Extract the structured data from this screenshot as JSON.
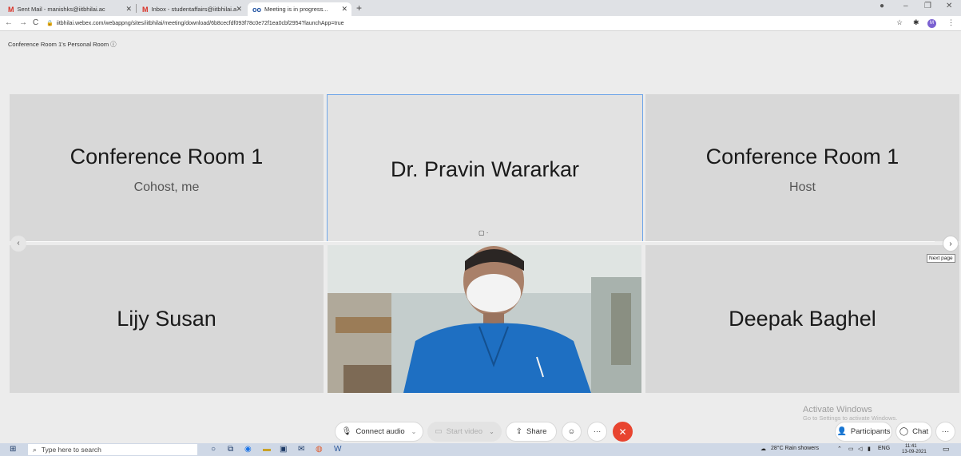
{
  "browser": {
    "tabs": [
      {
        "label": "Sent Mail - manishks@iitbhilai.ac",
        "favicon": "M",
        "active": false
      },
      {
        "label": "Inbox - studentaffairs@iitbhilai.a",
        "favicon": "M",
        "active": false
      },
      {
        "label": "Meeting is in progress...",
        "favicon": "oo",
        "active": true
      }
    ],
    "new_tab": "+",
    "url": "iitbhilai.webex.com/webappng/sites/iitbhilai/meeting/download/6b8cecfdf093f78c0e72f1ea0cbf2954?launchApp=true",
    "profile_initial": "M"
  },
  "meeting": {
    "room_title": "Conference Room 1's Personal Room ⓘ",
    "participants": [
      {
        "name": "Conference Room 1",
        "role": "Cohost, me"
      },
      {
        "name": "Dr. Pravin Wararkar",
        "role": ""
      },
      {
        "name": "Conference Room 1",
        "role": "Host"
      },
      {
        "name": "Lijy Susan",
        "role": ""
      },
      {
        "name": "",
        "role": "",
        "video": true
      },
      {
        "name": "Deepak Baghel",
        "role": ""
      }
    ],
    "next_page_tooltip": "Next page"
  },
  "controls": {
    "connect_audio": "Connect audio",
    "start_video": "Start video",
    "share": "Share",
    "participants": "Participants",
    "chat": "Chat",
    "more": "···",
    "end": "✕"
  },
  "watermark": {
    "line1": "Activate Windows",
    "line2": "Go to Settings to activate Windows."
  },
  "taskbar": {
    "search_placeholder": "Type here to search",
    "weather": "28°C  Rain showers",
    "language": "ENG",
    "time": "11:41",
    "date": "13-09-2021"
  },
  "colors": {
    "end_button": "#e8442f",
    "active_speaker_border": "#6ea5e8",
    "tile_bg": "#d8d8d8"
  }
}
